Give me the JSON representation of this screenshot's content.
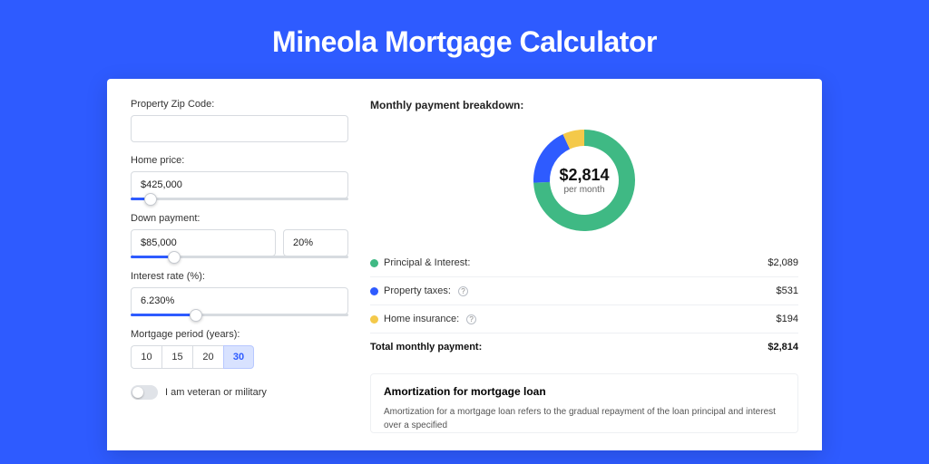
{
  "page_title": "Mineola Mortgage Calculator",
  "form": {
    "zip_label": "Property Zip Code:",
    "zip_value": "",
    "home_price_label": "Home price:",
    "home_price_value": "$425,000",
    "home_price_slider_pct": 9,
    "down_payment_label": "Down payment:",
    "down_payment_value": "$85,000",
    "down_payment_pct_value": "20%",
    "down_payment_slider_pct": 20,
    "interest_label": "Interest rate (%):",
    "interest_value": "6.230%",
    "interest_slider_pct": 30,
    "period_label": "Mortgage period (years):",
    "period_options": [
      "10",
      "15",
      "20",
      "30"
    ],
    "period_active_index": 3,
    "veteran_label": "I am veteran or military"
  },
  "breakdown": {
    "title": "Monthly payment breakdown:",
    "center_amount": "$2,814",
    "center_sub": "per month",
    "items": [
      {
        "label": "Principal & Interest:",
        "value": "$2,089",
        "color": "#3fb984",
        "info": false,
        "num": 2089
      },
      {
        "label": "Property taxes:",
        "value": "$531",
        "color": "#2e5bff",
        "info": true,
        "num": 531
      },
      {
        "label": "Home insurance:",
        "value": "$194",
        "color": "#f4c94a",
        "info": true,
        "num": 194
      }
    ],
    "total_label": "Total monthly payment:",
    "total_value": "$2,814"
  },
  "amortization": {
    "title": "Amortization for mortgage loan",
    "text": "Amortization for a mortgage loan refers to the gradual repayment of the loan principal and interest over a specified"
  },
  "chart_data": {
    "type": "pie",
    "title": "Monthly payment breakdown",
    "series": [
      {
        "name": "Principal & Interest",
        "value": 2089,
        "color": "#3fb984"
      },
      {
        "name": "Property taxes",
        "value": 531,
        "color": "#2e5bff"
      },
      {
        "name": "Home insurance",
        "value": 194,
        "color": "#f4c94a"
      }
    ],
    "total": 2814,
    "center_label": "$2,814 per month"
  }
}
